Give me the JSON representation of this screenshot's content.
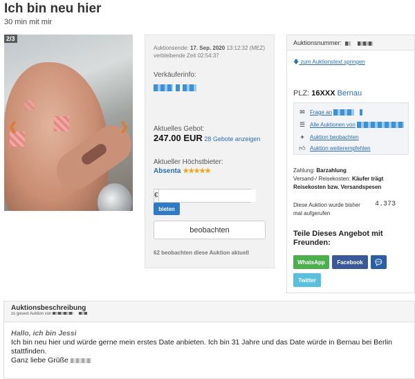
{
  "header": {
    "title": "Ich bin neu hier",
    "subtitle": "30 min mit mir"
  },
  "gallery": {
    "counter": "2/3",
    "prev_icon": "chevron-left-icon",
    "next_icon": "chevron-right-icon"
  },
  "auction": {
    "end_label": "Auktionsende:",
    "end_date": "17. Sep. 2020",
    "end_time": "13:12:32 (MEZ)",
    "remaining_label": "verbleibende Zeit",
    "remaining_time": "02:54:37",
    "seller_label": "Verkäuferinfo:",
    "current_bid_label": "Aktuelles Gebot:",
    "current_bid": "247.00 EUR",
    "bids_count": "28",
    "bids_link": "Gebote anzeigen",
    "highest_bidder_label": "Aktueller Höchstbieter:",
    "highest_bidder": "Absenta",
    "highest_bidder_stars": "★★★★★",
    "currency_symbol": "€",
    "bid_input_value": "",
    "bid_button": "bieten",
    "watch_button": "beobachten",
    "watchers_note": "62 beobachten diese Auktion aktuell"
  },
  "info": {
    "auction_number_label": "Auktionsnummer:",
    "jump_link": "zum Auktionstext springen",
    "plz_label": "PLZ:",
    "plz_value": "16XXX",
    "plz_city": "Bernau",
    "links": [
      {
        "icon": "envelope-icon",
        "label": "Frage an"
      },
      {
        "icon": "list-icon",
        "label": "Alle Auktionen von"
      },
      {
        "icon": "plus-icon",
        "label": "Auktion beobachten"
      },
      {
        "icon": "thumbs-up-icon",
        "label": "Auktion weiterempfehlen"
      }
    ],
    "payment_label": "Zahlung:",
    "payment_value": "Barzahlung",
    "shipping_label": "Versand-/ Reisekosten:",
    "shipping_value": "Käufer trägt Reisekosten bzw. Versandspesen",
    "views_text": "Diese Auktion wurde bisher mal aufgerufen",
    "views_count": "4.373",
    "share_title": "Teile Dieses Angebot mit Freunden:",
    "share": {
      "whatsapp": "WhatsApp",
      "facebook": "Facebook",
      "message_icon": "chat-icon",
      "twitter": "Twitter"
    }
  },
  "description": {
    "title": "Auktionsbeschreibung",
    "subtitle": "zu gesext Auktion von",
    "greeting": "Hallo, ich bin Jessi",
    "text": "Ich bin neu hier und würde gerne mein erstes Date anbieten. Ich bin 31 Jahre und das Date würde in Bernau bei Berlin stattfinden.",
    "closing": "Ganz liebe Grüße"
  },
  "colors": {
    "accent": "#2a6eab",
    "button_blue": "#2f7ac4",
    "whatsapp": "#4cae4c",
    "facebook": "#3b5998",
    "message": "#2a5fa8",
    "twitter": "#5bc0de",
    "stars": "#f0a81a"
  }
}
